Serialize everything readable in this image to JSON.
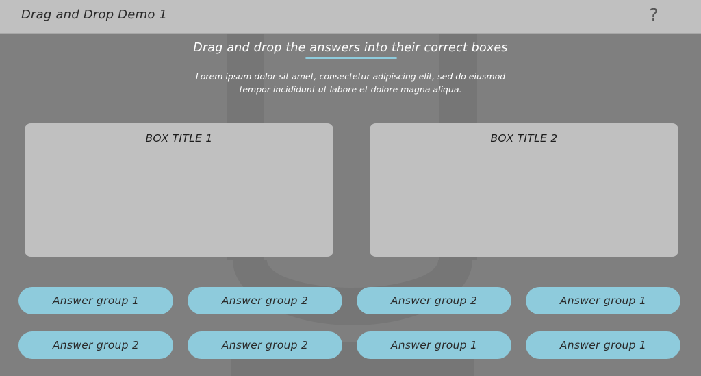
{
  "header": {
    "title": "Drag and Drop Demo 1",
    "help_label": "?"
  },
  "instruction": {
    "text": "Drag and drop the answers into their correct boxes",
    "description": "Lorem ipsum dolor sit amet, consectetur adipiscing elit, sed do eiusmod tempor incididunt ut labore et dolore magna aliqua."
  },
  "boxes": [
    {
      "title": "BOX TITLE 1"
    },
    {
      "title": "BOX TITLE 2"
    }
  ],
  "answers": [
    {
      "label": "Answer group 1"
    },
    {
      "label": "Answer group 2"
    },
    {
      "label": "Answer group 2"
    },
    {
      "label": "Answer group 1"
    },
    {
      "label": "Answer group 2"
    },
    {
      "label": "Answer group 2"
    },
    {
      "label": "Answer group 1"
    },
    {
      "label": "Answer group 1"
    }
  ],
  "colors": {
    "background": "#7f7f7f",
    "header": "#c0c0c0",
    "accent": "#8ecbdc",
    "box": "#c0c0c0"
  }
}
